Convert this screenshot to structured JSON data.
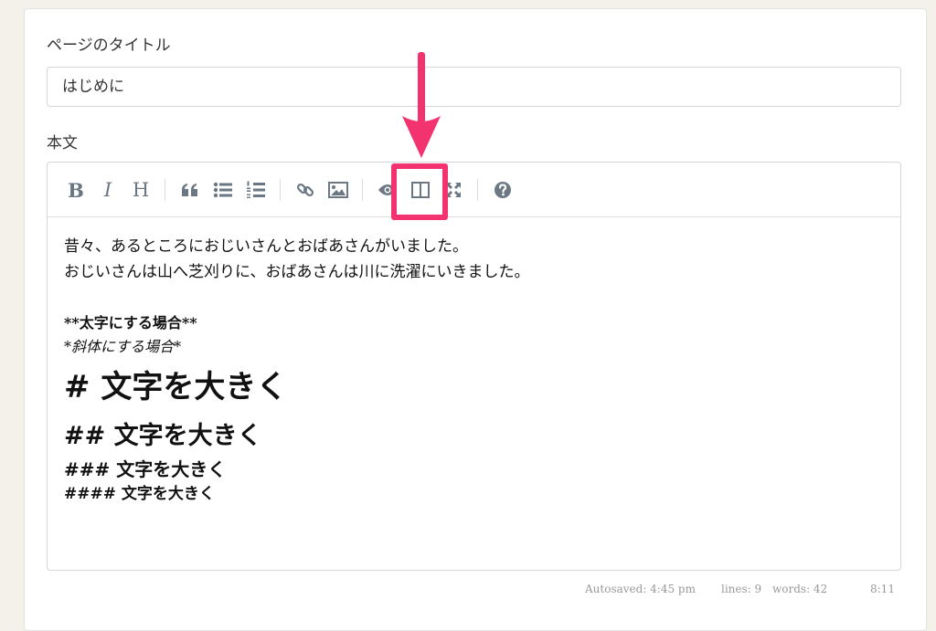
{
  "form": {
    "title_label": "ページのタイトル",
    "title_value": "はじめに",
    "body_label": "本文"
  },
  "toolbar": {
    "bold": "B",
    "italic": "I",
    "heading": "H",
    "highlighted_button": "side-by-side",
    "accent_color": "#f2336f"
  },
  "editor": {
    "lines": [
      "昔々、あるところにおじいさんとおばあさんがいました。",
      "おじいさんは山へ芝刈りに、おばあさんは川に洗濯にいきました。",
      "**太字にする場合**",
      "*斜体にする場合*",
      "# 文字を大きく",
      "## 文字を大きく",
      "### 文字を大きく",
      "#### 文字を大きく"
    ]
  },
  "statusbar": {
    "autosaved": "Autosaved: 4:45 pm",
    "lines": "lines: 9",
    "words": "words: 42",
    "cursor": "8:11"
  }
}
